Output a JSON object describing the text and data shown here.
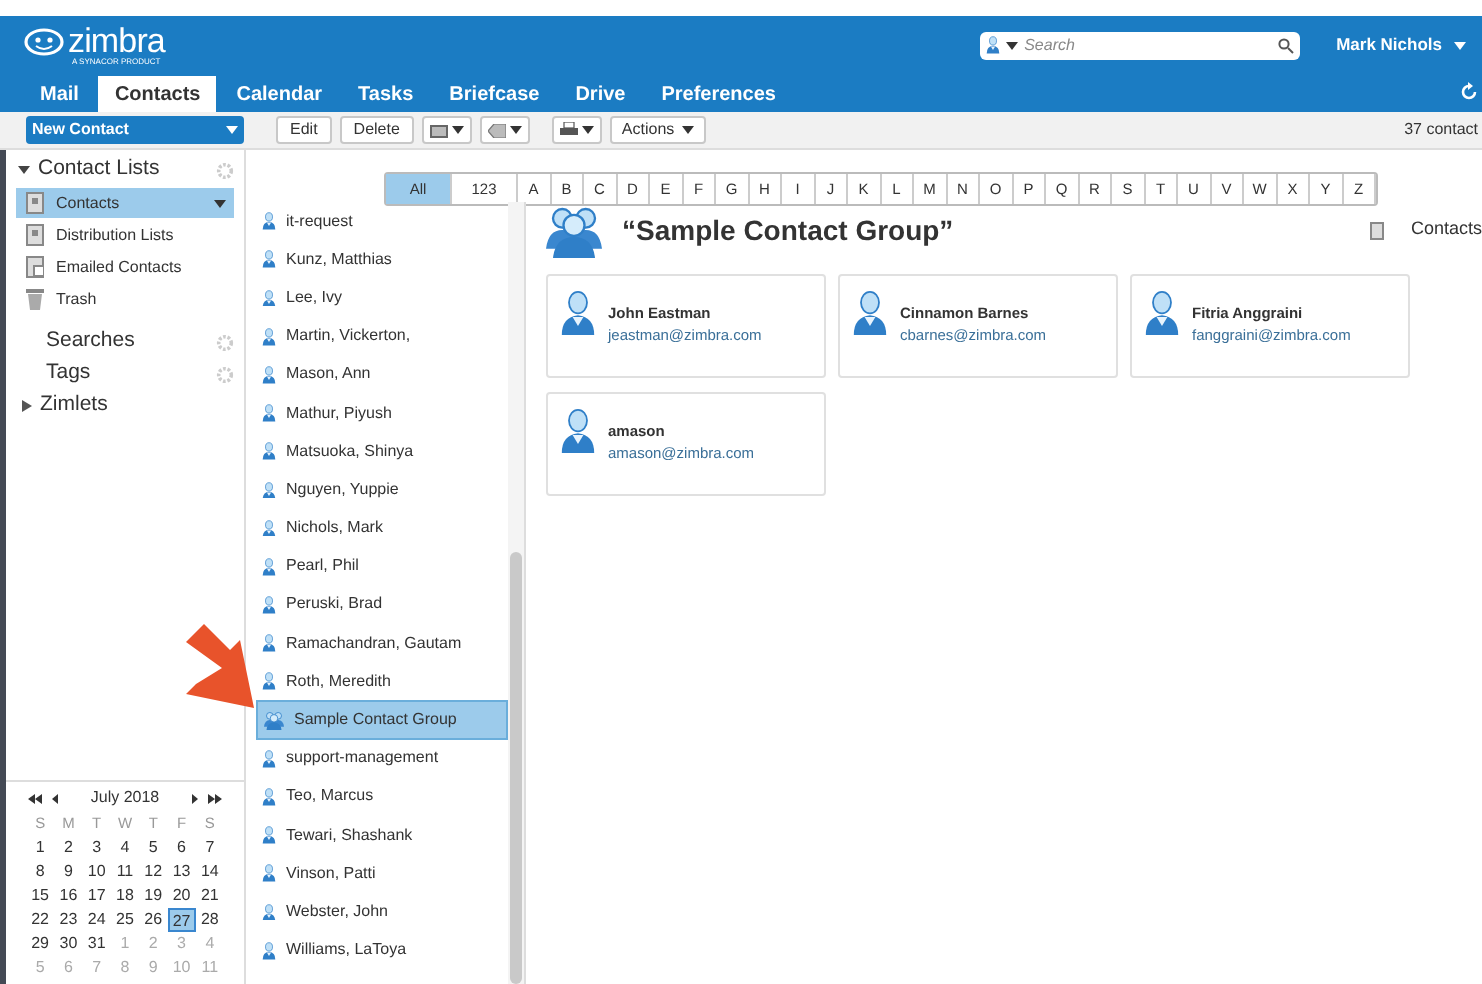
{
  "header": {
    "logo": "zimbra",
    "logo_sub": "A SYNACOR PRODUCT",
    "search": {
      "placeholder": "Search"
    },
    "user": "Mark Nichols"
  },
  "tabs": [
    {
      "label": "Mail",
      "selected": false
    },
    {
      "label": "Contacts",
      "selected": true
    },
    {
      "label": "Calendar",
      "selected": false
    },
    {
      "label": "Tasks",
      "selected": false
    },
    {
      "label": "Briefcase",
      "selected": false
    },
    {
      "label": "Drive",
      "selected": false
    },
    {
      "label": "Preferences",
      "selected": false
    }
  ],
  "toolbar": {
    "new_button": "New Contact",
    "buttons": [
      "Edit",
      "Delete"
    ],
    "actions": "Actions",
    "count": "37 contact"
  },
  "alphabet": [
    {
      "label": "All",
      "selected": true
    },
    {
      "label": "123",
      "selected": false
    },
    {
      "label": "A",
      "selected": false
    },
    {
      "label": "B",
      "selected": false
    },
    {
      "label": "C",
      "selected": false
    },
    {
      "label": "D",
      "selected": false
    },
    {
      "label": "E",
      "selected": false
    },
    {
      "label": "F",
      "selected": false
    },
    {
      "label": "G",
      "selected": false
    },
    {
      "label": "H",
      "selected": false
    },
    {
      "label": "I",
      "selected": false
    },
    {
      "label": "J",
      "selected": false
    },
    {
      "label": "K",
      "selected": false
    },
    {
      "label": "L",
      "selected": false
    },
    {
      "label": "M",
      "selected": false
    },
    {
      "label": "N",
      "selected": false
    },
    {
      "label": "O",
      "selected": false
    },
    {
      "label": "P",
      "selected": false
    },
    {
      "label": "Q",
      "selected": false
    },
    {
      "label": "R",
      "selected": false
    },
    {
      "label": "S",
      "selected": false
    },
    {
      "label": "T",
      "selected": false
    },
    {
      "label": "U",
      "selected": false
    },
    {
      "label": "V",
      "selected": false
    },
    {
      "label": "W",
      "selected": false
    },
    {
      "label": "X",
      "selected": false
    },
    {
      "label": "Y",
      "selected": false
    },
    {
      "label": "Z",
      "selected": false
    }
  ],
  "sidebar": {
    "contact_lists": {
      "label": "Contact Lists",
      "expanded": true,
      "items": [
        {
          "label": "Contacts",
          "kind": "book",
          "selected": true
        },
        {
          "label": "Distribution Lists",
          "kind": "book",
          "selected": false
        },
        {
          "label": "Emailed Contacts",
          "kind": "emailed",
          "selected": false
        },
        {
          "label": "Trash",
          "kind": "trash",
          "selected": false
        }
      ]
    },
    "sections": [
      {
        "label": "Searches",
        "kind": "gear"
      },
      {
        "label": "Tags",
        "kind": "gear"
      },
      {
        "label": "Zimlets",
        "kind": "expander"
      }
    ]
  },
  "calendar": {
    "title": "July 2018",
    "weekdays": [
      "S",
      "M",
      "T",
      "W",
      "T",
      "F",
      "S"
    ],
    "weeks": [
      [
        {
          "day": "1",
          "muted": false,
          "selected": false
        },
        {
          "day": "2",
          "muted": false,
          "selected": false
        },
        {
          "day": "3",
          "muted": false,
          "selected": false
        },
        {
          "day": "4",
          "muted": false,
          "selected": false
        },
        {
          "day": "5",
          "muted": false,
          "selected": false
        },
        {
          "day": "6",
          "muted": false,
          "selected": false
        },
        {
          "day": "7",
          "muted": false,
          "selected": false
        }
      ],
      [
        {
          "day": "8",
          "muted": false,
          "selected": false
        },
        {
          "day": "9",
          "muted": false,
          "selected": false
        },
        {
          "day": "10",
          "muted": false,
          "selected": false
        },
        {
          "day": "11",
          "muted": false,
          "selected": false
        },
        {
          "day": "12",
          "muted": false,
          "selected": false
        },
        {
          "day": "13",
          "muted": false,
          "selected": false
        },
        {
          "day": "14",
          "muted": false,
          "selected": false
        }
      ],
      [
        {
          "day": "15",
          "muted": false,
          "selected": false
        },
        {
          "day": "16",
          "muted": false,
          "selected": false
        },
        {
          "day": "17",
          "muted": false,
          "selected": false
        },
        {
          "day": "18",
          "muted": false,
          "selected": false
        },
        {
          "day": "19",
          "muted": false,
          "selected": false
        },
        {
          "day": "20",
          "muted": false,
          "selected": false
        },
        {
          "day": "21",
          "muted": false,
          "selected": false
        }
      ],
      [
        {
          "day": "22",
          "muted": false,
          "selected": false
        },
        {
          "day": "23",
          "muted": false,
          "selected": false
        },
        {
          "day": "24",
          "muted": false,
          "selected": false
        },
        {
          "day": "25",
          "muted": false,
          "selected": false
        },
        {
          "day": "26",
          "muted": false,
          "selected": false
        },
        {
          "day": "27",
          "muted": false,
          "selected": true
        },
        {
          "day": "28",
          "muted": false,
          "selected": false
        }
      ],
      [
        {
          "day": "29",
          "muted": false,
          "selected": false
        },
        {
          "day": "30",
          "muted": false,
          "selected": false
        },
        {
          "day": "31",
          "muted": false,
          "selected": false
        },
        {
          "day": "1",
          "muted": true,
          "selected": false
        },
        {
          "day": "2",
          "muted": true,
          "selected": false
        },
        {
          "day": "3",
          "muted": true,
          "selected": false
        },
        {
          "day": "4",
          "muted": true,
          "selected": false
        }
      ],
      [
        {
          "day": "5",
          "muted": true,
          "selected": false
        },
        {
          "day": "6",
          "muted": true,
          "selected": false
        },
        {
          "day": "7",
          "muted": true,
          "selected": false
        },
        {
          "day": "8",
          "muted": true,
          "selected": false
        },
        {
          "day": "9",
          "muted": true,
          "selected": false
        },
        {
          "day": "10",
          "muted": true,
          "selected": false
        },
        {
          "day": "11",
          "muted": true,
          "selected": false
        }
      ]
    ]
  },
  "contacts": [
    {
      "name": "it-request",
      "kind": "person",
      "selected": false
    },
    {
      "name": "Kunz, Matthias",
      "kind": "person",
      "selected": false
    },
    {
      "name": "Lee, Ivy",
      "kind": "person",
      "selected": false
    },
    {
      "name": "Martin, Vickerton,",
      "kind": "person",
      "selected": false
    },
    {
      "name": "Mason, Ann",
      "kind": "person",
      "selected": false
    },
    {
      "name": "Mathur, Piyush",
      "kind": "person",
      "selected": false
    },
    {
      "name": "Matsuoka, Shinya",
      "kind": "person",
      "selected": false
    },
    {
      "name": "Nguyen, Yuppie",
      "kind": "person",
      "selected": false
    },
    {
      "name": "Nichols, Mark",
      "kind": "person",
      "selected": false
    },
    {
      "name": "Pearl, Phil",
      "kind": "person",
      "selected": false
    },
    {
      "name": "Peruski, Brad",
      "kind": "person",
      "selected": false
    },
    {
      "name": "Ramachandran, Gautam",
      "kind": "person",
      "selected": false
    },
    {
      "name": "Roth, Meredith",
      "kind": "person",
      "selected": false
    },
    {
      "name": "Sample Contact Group",
      "kind": "group",
      "selected": true
    },
    {
      "name": "support-management",
      "kind": "person",
      "selected": false
    },
    {
      "name": "Teo, Marcus",
      "kind": "person",
      "selected": false
    },
    {
      "name": "Tewari, Shashank",
      "kind": "person",
      "selected": false
    },
    {
      "name": "Vinson, Patti",
      "kind": "person",
      "selected": false
    },
    {
      "name": "Webster, John",
      "kind": "person",
      "selected": false
    },
    {
      "name": "Williams, LaToya",
      "kind": "person",
      "selected": false
    }
  ],
  "detail": {
    "title": "“Sample Contact Group”",
    "folder": "Contacts",
    "members": [
      {
        "name": "John Eastman",
        "email": "jeastman@zimbra.com"
      },
      {
        "name": "Cinnamon Barnes",
        "email": "cbarnes@zimbra.com"
      },
      {
        "name": "Fitria Anggraini",
        "email": "fanggraini@zimbra.com"
      },
      {
        "name": "amason",
        "email": "amason@zimbra.com"
      }
    ]
  }
}
